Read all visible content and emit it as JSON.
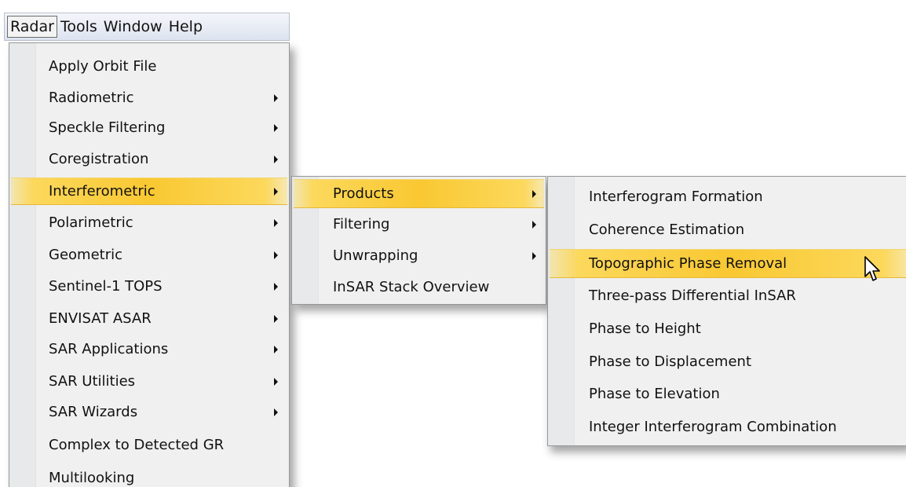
{
  "menubar": {
    "items": [
      {
        "label": "Radar",
        "active": true
      },
      {
        "label": "Tools",
        "active": false
      },
      {
        "label": "Window",
        "active": false
      },
      {
        "label": "Help",
        "active": false
      }
    ]
  },
  "radar_menu": {
    "items": [
      {
        "label": "Apply Orbit File",
        "submenu": false
      },
      {
        "label": "Radiometric",
        "submenu": true
      },
      {
        "label": "Speckle Filtering",
        "submenu": true
      },
      {
        "label": "Coregistration",
        "submenu": true
      },
      {
        "label": "Interferometric",
        "submenu": true,
        "highlighted": true
      },
      {
        "label": "Polarimetric",
        "submenu": true
      },
      {
        "label": "Geometric",
        "submenu": true
      },
      {
        "label": "Sentinel-1 TOPS",
        "submenu": true
      },
      {
        "label": "ENVISAT ASAR",
        "submenu": true
      },
      {
        "label": "SAR Applications",
        "submenu": true
      },
      {
        "label": "SAR Utilities",
        "submenu": true
      },
      {
        "label": "SAR Wizards",
        "submenu": true
      },
      {
        "label": "Complex to Detected GR",
        "submenu": false
      },
      {
        "label": "Multilooking",
        "submenu": false
      }
    ]
  },
  "interferometric_menu": {
    "items": [
      {
        "label": "Products",
        "submenu": true,
        "highlighted": true
      },
      {
        "label": "Filtering",
        "submenu": true
      },
      {
        "label": "Unwrapping",
        "submenu": true
      },
      {
        "label": "InSAR Stack Overview",
        "submenu": false
      }
    ]
  },
  "products_menu": {
    "items": [
      {
        "label": "Interferogram Formation"
      },
      {
        "label": "Coherence Estimation"
      },
      {
        "label": "Topographic Phase Removal",
        "highlighted": true
      },
      {
        "label": "Three-pass Differential InSAR"
      },
      {
        "label": "Phase to Height"
      },
      {
        "label": "Phase to Displacement"
      },
      {
        "label": "Phase to Elevation"
      },
      {
        "label": "Integer Interferogram Combination"
      }
    ]
  },
  "colors": {
    "highlight": "#f9c832",
    "menu_background": "#f0f0f0",
    "gutter": "#e7e9ea",
    "menubar": "#dde3ef"
  },
  "icons": {
    "cursor": "mouse-pointer-icon",
    "submenu": "submenu-arrow-icon"
  }
}
